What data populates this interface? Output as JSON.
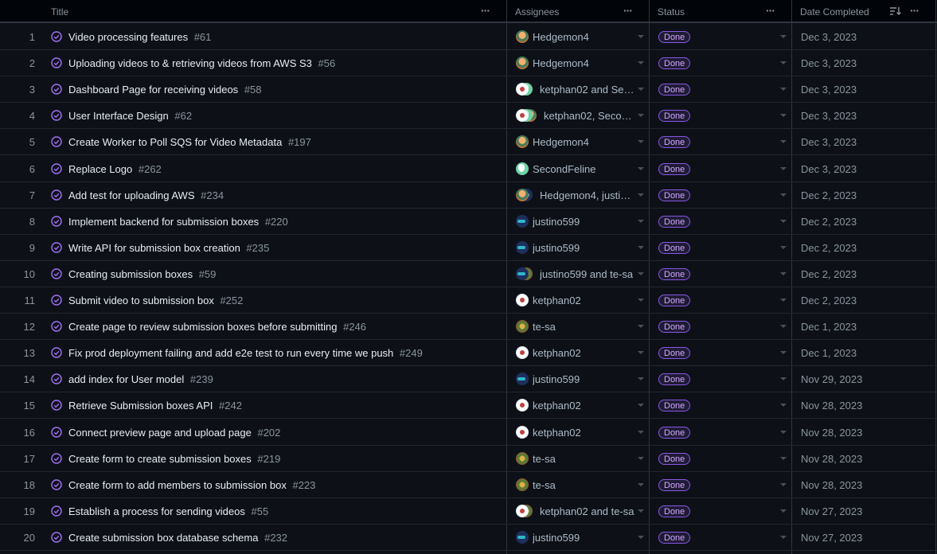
{
  "columns": {
    "title": "Title",
    "assignees": "Assignees",
    "status": "Status",
    "date_completed": "Date Completed"
  },
  "rows": [
    {
      "num": "1",
      "title": "Video processing features",
      "issue": "#61",
      "assignee": "Hedgemon4",
      "avatars": [
        "hedge"
      ],
      "status": "Done",
      "date": "Dec 3, 2023"
    },
    {
      "num": "2",
      "title": "Uploading videos to & retrieving videos from AWS S3",
      "issue": "#56",
      "assignee": "Hedgemon4",
      "avatars": [
        "hedge"
      ],
      "status": "Done",
      "date": "Dec 3, 2023"
    },
    {
      "num": "3",
      "title": "Dashboard Page for receiving videos",
      "issue": "#58",
      "assignee": "ketphan02 and Sec…",
      "avatars": [
        "ket",
        "second"
      ],
      "status": "Done",
      "date": "Dec 3, 2023"
    },
    {
      "num": "4",
      "title": "User Interface Design",
      "issue": "#62",
      "assignee": "ketphan02, Secon…",
      "avatars": [
        "ket",
        "second",
        "hedge"
      ],
      "status": "Done",
      "date": "Dec 3, 2023"
    },
    {
      "num": "5",
      "title": "Create Worker to Poll SQS for Video Metadata",
      "issue": "#197",
      "assignee": "Hedgemon4",
      "avatars": [
        "hedge"
      ],
      "status": "Done",
      "date": "Dec 3, 2023"
    },
    {
      "num": "6",
      "title": "Replace Logo",
      "issue": "#262",
      "assignee": "SecondFeline",
      "avatars": [
        "second"
      ],
      "status": "Done",
      "date": "Dec 3, 2023"
    },
    {
      "num": "7",
      "title": "Add test for uploading AWS",
      "issue": "#234",
      "assignee": "Hedgemon4, justi…",
      "avatars": [
        "hedge",
        "justi"
      ],
      "status": "Done",
      "date": "Dec 2, 2023"
    },
    {
      "num": "8",
      "title": "Implement backend for submission boxes",
      "issue": "#220",
      "assignee": "justino599",
      "avatars": [
        "justi"
      ],
      "status": "Done",
      "date": "Dec 2, 2023"
    },
    {
      "num": "9",
      "title": "Write API for submission box creation",
      "issue": "#235",
      "assignee": "justino599",
      "avatars": [
        "justi"
      ],
      "status": "Done",
      "date": "Dec 2, 2023"
    },
    {
      "num": "10",
      "title": "Creating submission boxes",
      "issue": "#59",
      "assignee": "justino599 and te-sa",
      "avatars": [
        "justi",
        "tesa"
      ],
      "status": "Done",
      "date": "Dec 2, 2023"
    },
    {
      "num": "11",
      "title": "Submit video to submission box",
      "issue": "#252",
      "assignee": "ketphan02",
      "avatars": [
        "ket"
      ],
      "status": "Done",
      "date": "Dec 2, 2023"
    },
    {
      "num": "12",
      "title": "Create page to review submission boxes before submitting",
      "issue": "#246",
      "assignee": "te-sa",
      "avatars": [
        "tesa"
      ],
      "status": "Done",
      "date": "Dec 1, 2023"
    },
    {
      "num": "13",
      "title": "Fix prod deployment failing and add e2e test to run every time we push",
      "issue": "#249",
      "assignee": "ketphan02",
      "avatars": [
        "ket"
      ],
      "status": "Done",
      "date": "Dec 1, 2023"
    },
    {
      "num": "14",
      "title": "add index for User model",
      "issue": "#239",
      "assignee": "justino599",
      "avatars": [
        "justi"
      ],
      "status": "Done",
      "date": "Nov 29, 2023"
    },
    {
      "num": "15",
      "title": "Retrieve Submission boxes API",
      "issue": "#242",
      "assignee": "ketphan02",
      "avatars": [
        "ket"
      ],
      "status": "Done",
      "date": "Nov 28, 2023"
    },
    {
      "num": "16",
      "title": "Connect preview page and upload page",
      "issue": "#202",
      "assignee": "ketphan02",
      "avatars": [
        "ket"
      ],
      "status": "Done",
      "date": "Nov 28, 2023"
    },
    {
      "num": "17",
      "title": "Create form to create submission boxes",
      "issue": "#219",
      "assignee": "te-sa",
      "avatars": [
        "tesa"
      ],
      "status": "Done",
      "date": "Nov 28, 2023"
    },
    {
      "num": "18",
      "title": "Create form to add members to submission box",
      "issue": "#223",
      "assignee": "te-sa",
      "avatars": [
        "tesa"
      ],
      "status": "Done",
      "date": "Nov 28, 2023"
    },
    {
      "num": "19",
      "title": "Establish a process for sending videos",
      "issue": "#55",
      "assignee": "ketphan02 and te-sa",
      "avatars": [
        "ket",
        "tesa"
      ],
      "status": "Done",
      "date": "Nov 27, 2023"
    },
    {
      "num": "20",
      "title": "Create submission box database schema",
      "issue": "#232",
      "assignee": "justino599",
      "avatars": [
        "justi"
      ],
      "status": "Done",
      "date": "Nov 27, 2023"
    }
  ],
  "colors": {
    "background": "#0d1117",
    "done_accent": "#8957e5",
    "done_text": "#d2a8ff",
    "issue_closed_icon": "#a371f7"
  },
  "icons": {
    "issue": "issue-closed-circle-check-icon",
    "column_menu": "more-horizontal-icon",
    "sort": "sort-descending-icon",
    "field_dropdown": "chevron-down-icon"
  }
}
